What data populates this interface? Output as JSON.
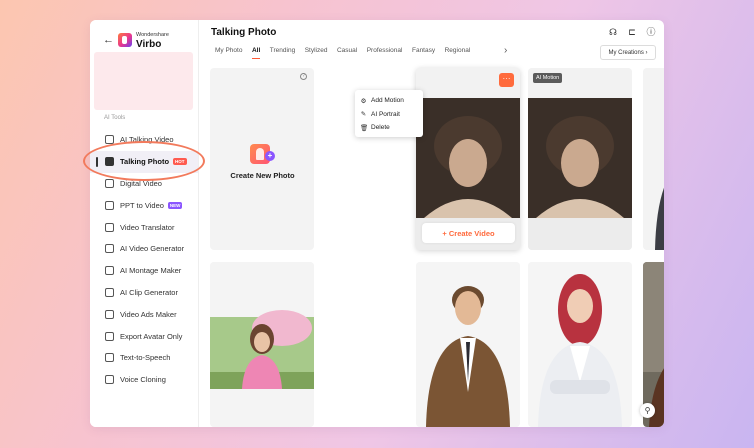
{
  "sidebar": {
    "back_icon": "arrow-left-icon",
    "brand_small": "Wondershare",
    "brand_name": "Virbo",
    "section_label": "AI Tools",
    "items": [
      {
        "label": "AI Talking Video",
        "icon": "video-avatar-icon"
      },
      {
        "label": "Talking Photo",
        "icon": "photo-icon",
        "badge": "HOT",
        "active": true
      },
      {
        "label": "Digital Video",
        "icon": "digital-video-icon"
      },
      {
        "label": "PPT to Video",
        "icon": "ppt-icon",
        "badge": "NEW"
      },
      {
        "label": "Video Translator",
        "icon": "translate-icon"
      },
      {
        "label": "AI Video Generator",
        "icon": "video-generator-icon"
      },
      {
        "label": "AI Montage Maker",
        "icon": "montage-icon"
      },
      {
        "label": "AI Clip Generator",
        "icon": "clip-icon"
      },
      {
        "label": "Video Ads Maker",
        "icon": "ads-icon"
      },
      {
        "label": "Export Avatar Only",
        "icon": "export-avatar-icon"
      },
      {
        "label": "Text-to-Speech",
        "icon": "tts-icon"
      },
      {
        "label": "Voice Cloning",
        "icon": "voice-clone-icon"
      }
    ]
  },
  "header": {
    "title": "Talking Photo",
    "icons": [
      "headset-icon",
      "bookmark-icon",
      "help-icon"
    ]
  },
  "tabs": [
    {
      "label": "My Photo"
    },
    {
      "label": "All",
      "active": true
    },
    {
      "label": "Trending"
    },
    {
      "label": "Stylized"
    },
    {
      "label": "Casual"
    },
    {
      "label": "Professional"
    },
    {
      "label": "Fantasy"
    },
    {
      "label": "Regional"
    }
  ],
  "my_creations_label": "My Creations",
  "create_card": {
    "label": "Create New Photo",
    "help": "?"
  },
  "hover_card": {
    "more": "···",
    "create_video": "+ Create Video"
  },
  "ai_motion_tag": "AI Motion",
  "context_menu": [
    {
      "label": "Add Motion",
      "icon": "motion-icon"
    },
    {
      "label": "AI Portrait",
      "icon": "portrait-wand-icon"
    },
    {
      "label": "Delete",
      "icon": "trash-icon"
    }
  ],
  "colors": {
    "accent": "#ff6b3d",
    "hot_badge": "#ff5a4f",
    "new_badge": "#8b55ff",
    "highlight_ring": "#f27a5c"
  }
}
